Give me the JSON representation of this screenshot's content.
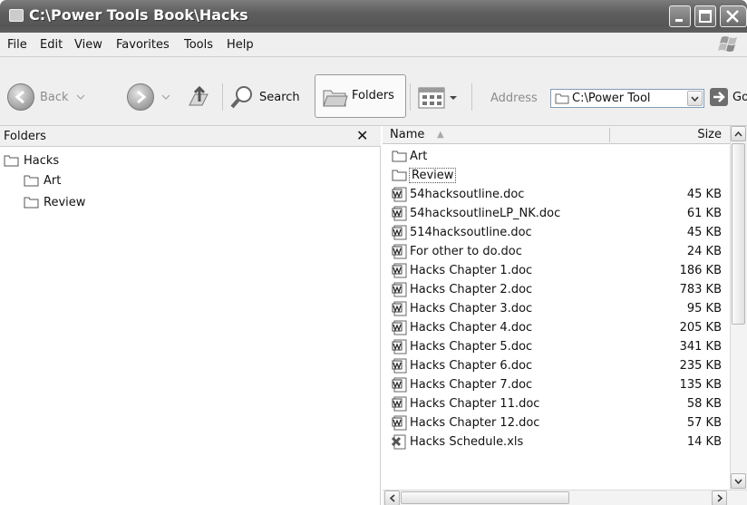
{
  "window": {
    "title": "C:\\Power Tools Book\\Hacks",
    "controls": [
      "minimize",
      "maximize",
      "close"
    ]
  },
  "menubar": {
    "items": [
      "File",
      "Edit",
      "View",
      "Favorites",
      "Tools",
      "Help"
    ]
  },
  "toolbar": {
    "back_label": "Back",
    "search_label": "Search",
    "folders_label": "Folders",
    "address_label": "Address",
    "address_value": "C:\\Power Tool",
    "go_label": "Go"
  },
  "folders_pane": {
    "title": "Folders",
    "close_glyph": "✕",
    "tree": [
      {
        "label": "Hacks",
        "level": 0
      },
      {
        "label": "Art",
        "level": 1
      },
      {
        "label": "Review",
        "level": 1
      }
    ]
  },
  "file_list": {
    "columns": {
      "name": "Name",
      "size": "Size"
    },
    "sort_glyph": "▲",
    "rows": [
      {
        "name": "Art",
        "size": "",
        "type": "folder"
      },
      {
        "name": "Review",
        "size": "",
        "type": "folder"
      },
      {
        "name": "54hacksoutline.doc",
        "size": "45 KB",
        "type": "doc"
      },
      {
        "name": "54hacksoutlineLP_NK.doc",
        "size": "61 KB",
        "type": "doc"
      },
      {
        "name": "514hacksoutline.doc",
        "size": "45 KB",
        "type": "doc"
      },
      {
        "name": "For other to do.doc",
        "size": "24 KB",
        "type": "doc"
      },
      {
        "name": "Hacks Chapter 1.doc",
        "size": "186 KB",
        "type": "doc"
      },
      {
        "name": "Hacks Chapter 2.doc",
        "size": "783 KB",
        "type": "doc"
      },
      {
        "name": "Hacks Chapter 3.doc",
        "size": "95 KB",
        "type": "doc"
      },
      {
        "name": "Hacks Chapter 4.doc",
        "size": "205 KB",
        "type": "doc"
      },
      {
        "name": "Hacks Chapter 5.doc",
        "size": "341 KB",
        "type": "doc"
      },
      {
        "name": "Hacks Chapter 6.doc",
        "size": "235 KB",
        "type": "doc"
      },
      {
        "name": "Hacks Chapter 7.doc",
        "size": "135 KB",
        "type": "doc"
      },
      {
        "name": "Hacks Chapter 11.doc",
        "size": "58 KB",
        "type": "doc"
      },
      {
        "name": "Hacks Chapter 12.doc",
        "size": "57 KB",
        "type": "doc"
      },
      {
        "name": "Hacks Schedule.xls",
        "size": "14 KB",
        "type": "xls"
      }
    ]
  },
  "colors": {
    "titlebar": "#5e5e5e",
    "chrome": "#efefef",
    "address_border": "#7f9db9"
  }
}
